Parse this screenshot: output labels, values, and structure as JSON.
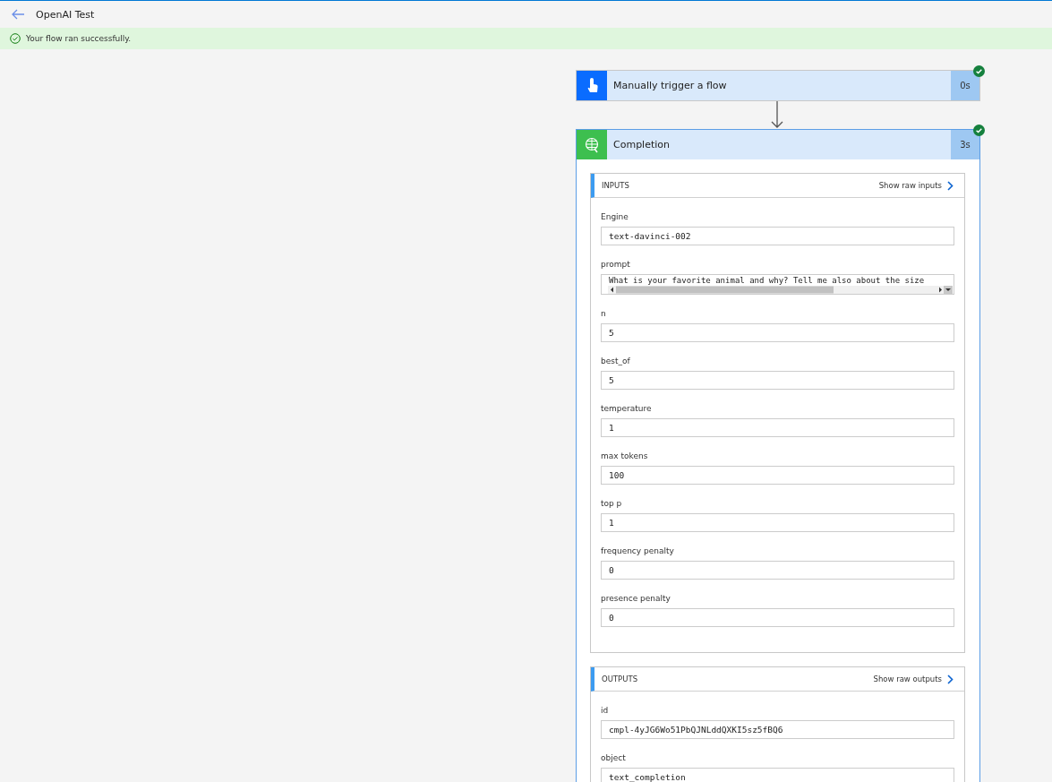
{
  "header": {
    "title": "OpenAI Test"
  },
  "banner": {
    "message": "Your flow ran successfully.",
    "success": true
  },
  "steps": [
    {
      "kind": "trigger",
      "title": "Manually trigger a flow",
      "duration": "0s",
      "succeeded": true
    },
    {
      "kind": "action",
      "title": "Completion",
      "duration": "3s",
      "succeeded": true,
      "sections": [
        {
          "title": "INPUTS",
          "link": "Show raw inputs",
          "fields": [
            {
              "label": "Engine",
              "value": "text-davinci-002",
              "kind": "text"
            },
            {
              "label": "prompt",
              "value": "What is your favorite animal and why? Tell me also about the size",
              "kind": "scrollable"
            },
            {
              "label": "n",
              "value": "5",
              "kind": "text"
            },
            {
              "label": "best_of",
              "value": "5",
              "kind": "text"
            },
            {
              "label": "temperature",
              "value": "1",
              "kind": "text"
            },
            {
              "label": "max tokens",
              "value": "100",
              "kind": "text"
            },
            {
              "label": "top p",
              "value": "1",
              "kind": "text"
            },
            {
              "label": "frequency penalty",
              "value": "0",
              "kind": "text"
            },
            {
              "label": "presence penalty",
              "value": "0",
              "kind": "text"
            }
          ]
        },
        {
          "title": "OUTPUTS",
          "link": "Show raw outputs",
          "fields": [
            {
              "label": "id",
              "value": "cmpl-4yJG6Wo51PbQJNLddQXKI5sz5fBQ6",
              "kind": "text"
            },
            {
              "label": "object",
              "value": "text_completion",
              "kind": "text"
            }
          ]
        }
      ]
    }
  ]
}
